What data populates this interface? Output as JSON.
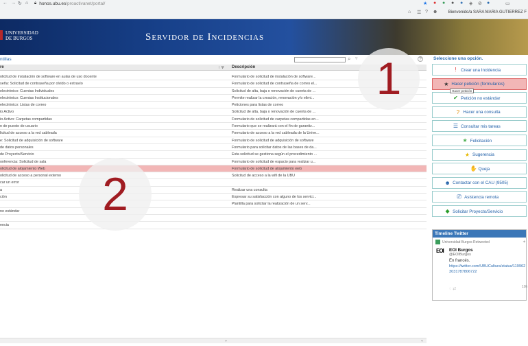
{
  "browser": {
    "nav_icons": [
      "back-icon",
      "forward-icon",
      "reload-icon",
      "home-icon",
      "lock-icon"
    ],
    "url_host": "honos.ubu.es",
    "url_path": "/proactivanet/portal/",
    "welcome": "Bienvenido/a SARA MARIA GUTIERREZ F"
  },
  "banner": {
    "university_line1": "UNIVERSIDAD",
    "university_line2": "DE BURGOS",
    "title": "Servidor de Incidencias"
  },
  "left": {
    "tab_title": "ntillas",
    "columns": {
      "name": "re",
      "description": "Descripción"
    },
    "rows": [
      {
        "name": "olicitud de instalación de software en aulas de uso docente",
        "desc": "Formulario de solicitud de instalación de software..."
      },
      {
        "name": "seña: Solicitud de contraseña por olvido o extravío",
        "desc": "Formulario de solicitud de contraseña de correo el..."
      },
      {
        "name": "electrónico: Cuentas Individuales",
        "desc": "Solicitud de alta, baja o renovación de cuenta de ..."
      },
      {
        "name": "electrónico: Cuentas Institucionales",
        "desc": "Permite realizar la creación, renovación y/o elimi..."
      },
      {
        "name": "electrónico: Listas de correo",
        "desc": "Peticiones para listas de correo"
      },
      {
        "name": "io Activo",
        "desc": "Solicitud de alta, baja o renovación de cuenta de ..."
      },
      {
        "name": "io Activo: Carpetas compartidas",
        "desc": "Formulario de solicitud de carpetas compartidas en..."
      },
      {
        "name": "n de puesto de usuario",
        "desc": "Formulario que se realizará con el fin de garantiz..."
      },
      {
        "name": "licitud de acceso a la red cableada",
        "desc": "Formulario de acceso a la red cableada de la Unive..."
      },
      {
        "name": "e: Solicitud de adquisición de software",
        "desc": "Formulario de solicitud de adquisición de software"
      },
      {
        "name": "de datos personales",
        "desc": "Formulario para solicitar datos de las bases de da..."
      },
      {
        "name": "de Proyecto/Servicio",
        "desc": "Esta solicitud se gestiona según el procedimiento ..."
      },
      {
        "name": "onferencia: Solicitud de sala",
        "desc": "Formulario de solicitud de espacio para realizar u..."
      },
      {
        "name": "olicitud de alojamiento Web",
        "desc": "Formulario de solicitud de alojamiento web",
        "selected": true
      },
      {
        "name": "olicitud de acceso a personal externo",
        "desc": "Solicitud de acceso a la wifi de la UBU"
      },
      {
        "name": "car un error",
        "desc": ""
      },
      {
        "name": "a",
        "desc": "Realizar una consulta"
      },
      {
        "name": "ción",
        "desc": "Expresar su satisfacción con alguno de los servici..."
      },
      {
        "name": "",
        "desc": "Plantilla para solicitar la realización de un serv..."
      },
      {
        "name": "no estándar",
        "desc": ""
      },
      {
        "name": "",
        "desc": ""
      },
      {
        "name": "encia",
        "desc": ""
      }
    ],
    "annotation_2": "2"
  },
  "right": {
    "title": "Seleccione una opción.",
    "options": [
      {
        "label": "Crear una Incidencia",
        "icon": "alert-icon",
        "glyph": "!",
        "color": "#d33"
      },
      {
        "label": "Hacer petición (formularios)",
        "icon": "form-icon",
        "glyph": "★",
        "color": "#333",
        "selected": true
      },
      {
        "label": "Petición no estándar",
        "icon": "check-icon",
        "glyph": "✔",
        "color": "#2a9d2a"
      },
      {
        "label": "Hacer una consulta",
        "icon": "question-icon",
        "glyph": "?",
        "color": "#e08a00"
      },
      {
        "label": "Consultar mis tareas",
        "icon": "list-icon",
        "glyph": "☰",
        "color": "#2b6cb0"
      },
      {
        "label": "Felicitación",
        "icon": "star-icon",
        "glyph": "★",
        "color": "#4caf50"
      },
      {
        "label": "Sugerencia",
        "icon": "lightbulb-icon",
        "glyph": "★",
        "color": "#e6b800"
      },
      {
        "label": "Queja",
        "icon": "complaint-icon",
        "glyph": "✋",
        "color": "#c62828"
      },
      {
        "label": "Contactar con el CAU (9505)",
        "icon": "contact-icon",
        "glyph": "☻",
        "color": "#1f5fa8"
      },
      {
        "label": "Asistencia remota",
        "icon": "remote-icon",
        "glyph": "⎚",
        "color": "#1f5fa8"
      },
      {
        "label": "Solicitar Proyecto/Servicio",
        "icon": "project-icon",
        "glyph": "◆",
        "color": "#2a9d2a"
      }
    ],
    "tooltip": "Hacer petición",
    "annotation_1": "1",
    "twitter": {
      "title": "Timeline Twitter",
      "retweeted": "Universidad Burgos Retweeted",
      "logo": "EOI",
      "name": "EOI Burgos",
      "handle": "@EOIBurgos",
      "text": "En francés.",
      "link": "https://twitter.com/UBUCultura/status/1199623031787806722",
      "time": "10h"
    }
  }
}
